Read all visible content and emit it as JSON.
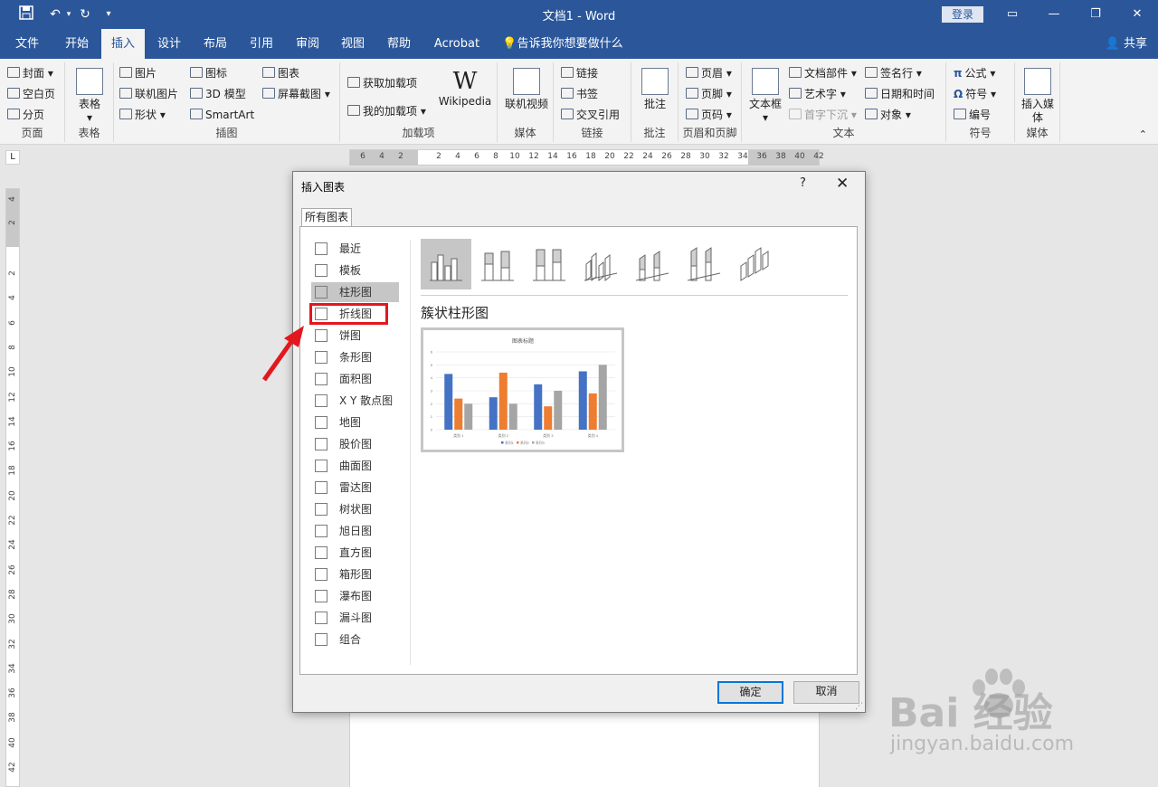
{
  "window": {
    "doc_title": "文档1 - Word",
    "login_label": "登录",
    "share_label": "共享",
    "help_search": "告诉我你想要做什么"
  },
  "tabs": [
    {
      "label": "文件"
    },
    {
      "label": "开始"
    },
    {
      "label": "插入"
    },
    {
      "label": "设计"
    },
    {
      "label": "布局"
    },
    {
      "label": "引用"
    },
    {
      "label": "审阅"
    },
    {
      "label": "视图"
    },
    {
      "label": "帮助"
    },
    {
      "label": "Acrobat"
    }
  ],
  "ribbon": {
    "pages": {
      "label": "页面",
      "items": [
        "封面",
        "空白页",
        "分页"
      ]
    },
    "tables": {
      "label": "表格",
      "button": "表格"
    },
    "illustrations": {
      "label": "插图",
      "items": [
        "图片",
        "联机图片",
        "形状",
        "图标",
        "3D 模型",
        "SmartArt",
        "图表",
        "屏幕截图"
      ]
    },
    "addins": {
      "label": "加载项",
      "items": [
        "获取加载项",
        "我的加载项"
      ],
      "wikipedia": "Wikipedia"
    },
    "media": {
      "label": "媒体",
      "button": "联机视频"
    },
    "links": {
      "label": "链接",
      "items": [
        "链接",
        "书签",
        "交叉引用"
      ]
    },
    "comments": {
      "label": "批注",
      "button": "批注"
    },
    "header_footer": {
      "label": "页眉和页脚",
      "items": [
        "页眉",
        "页脚",
        "页码"
      ]
    },
    "text": {
      "label": "文本",
      "textbox": "文本框",
      "items": [
        "文档部件",
        "艺术字",
        "首字下沉",
        "签名行",
        "日期和时间",
        "对象"
      ]
    },
    "symbols": {
      "label": "符号",
      "items": [
        "公式",
        "符号",
        "编号"
      ]
    },
    "media2": {
      "label": "媒体",
      "button": "插入媒体"
    }
  },
  "ruler": {
    "h_ticks": [
      "6",
      "4",
      "2",
      "2",
      "4",
      "6",
      "8",
      "10",
      "12",
      "14",
      "16",
      "18",
      "20",
      "22",
      "24",
      "26",
      "28",
      "30",
      "32",
      "34",
      "36",
      "38",
      "40",
      "42"
    ],
    "v_ticks": [
      "4",
      "2",
      "2",
      "4",
      "6",
      "8",
      "10",
      "12",
      "14",
      "16",
      "18",
      "20",
      "22",
      "24",
      "26",
      "28",
      "30",
      "32",
      "34",
      "36",
      "38",
      "40",
      "42"
    ],
    "tabstop": "L"
  },
  "dialog": {
    "title": "插入图表",
    "help": "?",
    "close": "✕",
    "tab": "所有图表",
    "categories": [
      {
        "label": "最近"
      },
      {
        "label": "模板"
      },
      {
        "label": "柱形图"
      },
      {
        "label": "折线图"
      },
      {
        "label": "饼图"
      },
      {
        "label": "条形图"
      },
      {
        "label": "面积图"
      },
      {
        "label": "X Y 散点图"
      },
      {
        "label": "地图"
      },
      {
        "label": "股价图"
      },
      {
        "label": "曲面图"
      },
      {
        "label": "雷达图"
      },
      {
        "label": "树状图"
      },
      {
        "label": "旭日图"
      },
      {
        "label": "直方图"
      },
      {
        "label": "箱形图"
      },
      {
        "label": "瀑布图"
      },
      {
        "label": "漏斗图"
      },
      {
        "label": "组合"
      }
    ],
    "selected_category": "柱形图",
    "highlighted_category": "折线图",
    "subtype_name": "簇状柱形图",
    "ok_label": "确定",
    "cancel_label": "取消"
  },
  "chart_data": {
    "type": "bar",
    "title": "图表标题",
    "categories": [
      "类别 1",
      "类别 2",
      "类别 3",
      "类别 4"
    ],
    "series": [
      {
        "name": "系列1",
        "values": [
          4.3,
          2.5,
          3.5,
          4.5
        ],
        "color": "#4472c4"
      },
      {
        "name": "系列2",
        "values": [
          2.4,
          4.4,
          1.8,
          2.8
        ],
        "color": "#ed7d31"
      },
      {
        "name": "系列3",
        "values": [
          2,
          2,
          3,
          5
        ],
        "color": "#a5a5a5"
      }
    ],
    "yticks": [
      "0",
      "1",
      "2",
      "3",
      "4",
      "5",
      "6"
    ],
    "ylim": [
      0,
      6
    ],
    "legend": "bottom",
    "grid": true
  },
  "watermark": {
    "logo": "Bai  经验",
    "sub": "jingyan.baidu.com"
  },
  "colors": {
    "brand": "#2b579a",
    "highlight": "#e3171e",
    "selected": "#c6c6c6"
  }
}
